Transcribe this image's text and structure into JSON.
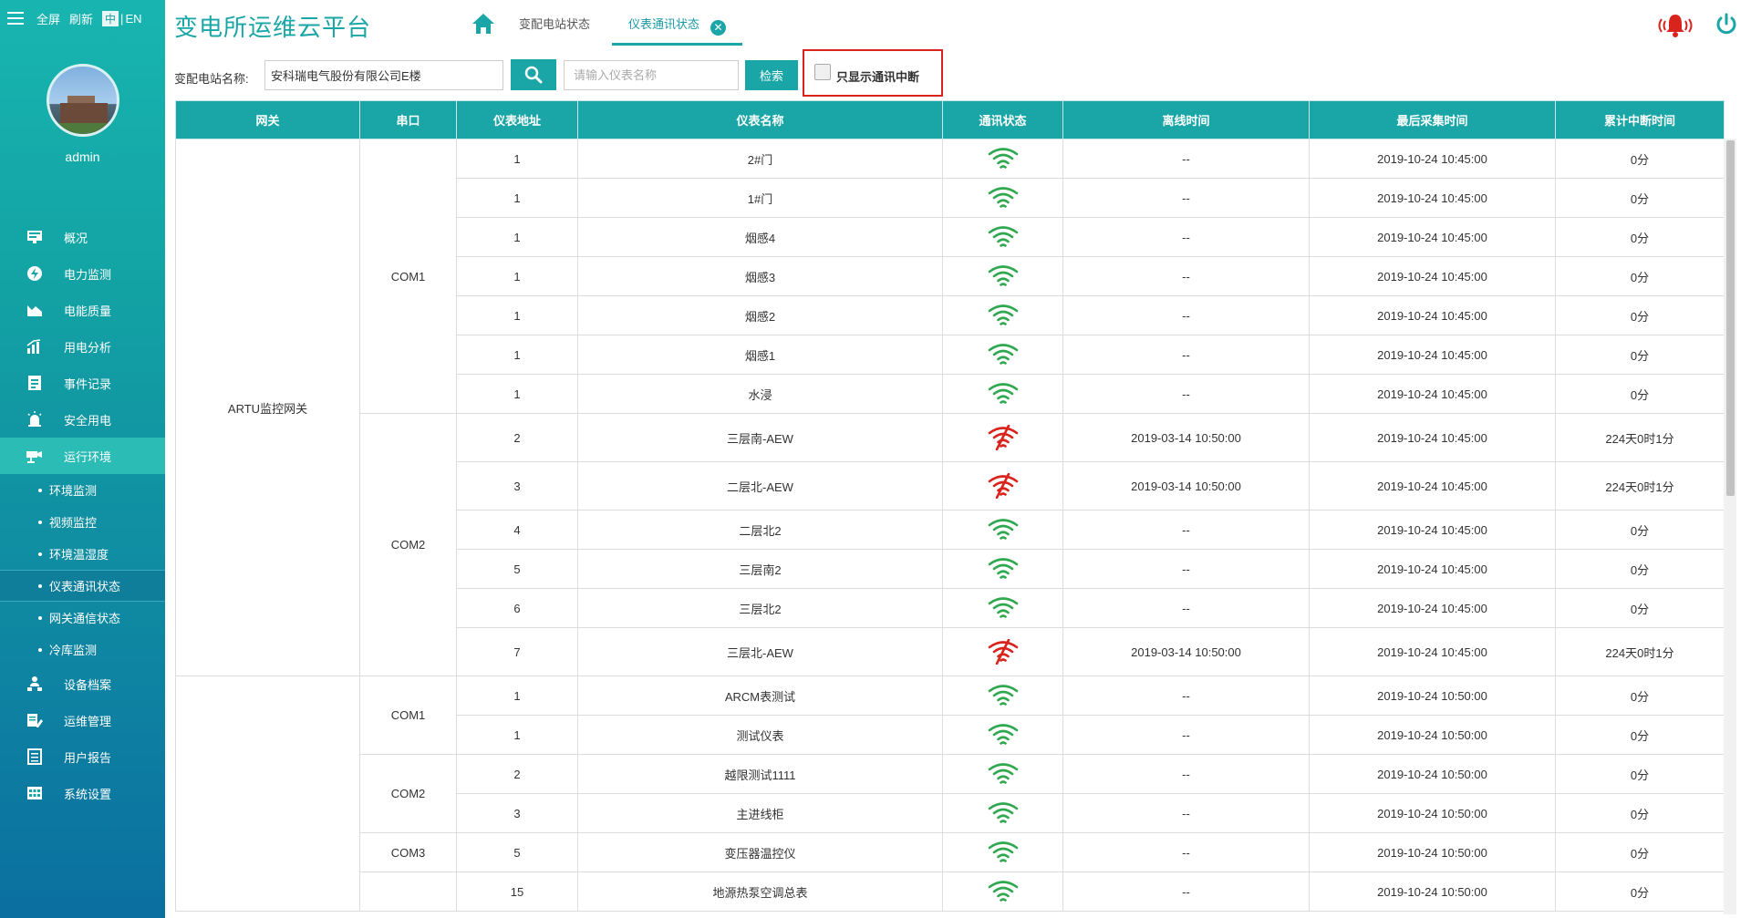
{
  "topbar": {
    "fullscreen": "全屏",
    "refresh": "刷新",
    "lang_zh": "中",
    "lang_sep": "|",
    "lang_en": "EN"
  },
  "user": {
    "name": "admin"
  },
  "nav": [
    {
      "label": "概况",
      "icon": "monitor-icon"
    },
    {
      "label": "电力监测",
      "icon": "power-monitor-icon"
    },
    {
      "label": "电能质量",
      "icon": "quality-chart-icon"
    },
    {
      "label": "用电分析",
      "icon": "bar-chart-icon"
    },
    {
      "label": "事件记录",
      "icon": "document-icon"
    },
    {
      "label": "安全用电",
      "icon": "alarm-light-icon"
    },
    {
      "label": "运行环境",
      "icon": "camera-icon",
      "active": true
    }
  ],
  "subnav": [
    {
      "label": "环境监测"
    },
    {
      "label": "视频监控"
    },
    {
      "label": "环境温湿度"
    },
    {
      "label": "仪表通讯状态",
      "active": true
    },
    {
      "label": "网关通信状态"
    },
    {
      "label": "冷库监测"
    }
  ],
  "nav_bottom": [
    {
      "label": "设备档案",
      "icon": "org-chart-icon"
    },
    {
      "label": "运维管理",
      "icon": "edit-doc-icon"
    },
    {
      "label": "用户报告",
      "icon": "report-icon"
    },
    {
      "label": "系统设置",
      "icon": "settings-grid-icon"
    }
  ],
  "header": {
    "title": "变电所运维云平台",
    "tabs": [
      "变配电站状态",
      "仪表通讯状态"
    ],
    "close_glyph": "✕"
  },
  "filter": {
    "station_label": "变配电站名称:",
    "station_value": "安科瑞电气股份有限公司E楼",
    "meter_placeholder": "请输入仪表名称",
    "query_label": "检索",
    "only_offline_label": "只显示通讯中断"
  },
  "table": {
    "columns": [
      "网关",
      "串口",
      "仪表地址",
      "仪表名称",
      "通讯状态",
      "离线时间",
      "最后采集时间",
      "累计中断时间"
    ],
    "groups": [
      {
        "gateway": "ARTU监控网关",
        "ports": [
          {
            "port": "COM1",
            "rows": [
              {
                "addr": "1",
                "name": "2#门",
                "ok": true,
                "offline": "--",
                "last": "2019-10-24 10:45:00",
                "total": "0分"
              },
              {
                "addr": "1",
                "name": "1#门",
                "ok": true,
                "offline": "--",
                "last": "2019-10-24 10:45:00",
                "total": "0分"
              },
              {
                "addr": "1",
                "name": "烟感4",
                "ok": true,
                "offline": "--",
                "last": "2019-10-24 10:45:00",
                "total": "0分"
              },
              {
                "addr": "1",
                "name": "烟感3",
                "ok": true,
                "offline": "--",
                "last": "2019-10-24 10:45:00",
                "total": "0分"
              },
              {
                "addr": "1",
                "name": "烟感2",
                "ok": true,
                "offline": "--",
                "last": "2019-10-24 10:45:00",
                "total": "0分"
              },
              {
                "addr": "1",
                "name": "烟感1",
                "ok": true,
                "offline": "--",
                "last": "2019-10-24 10:45:00",
                "total": "0分"
              },
              {
                "addr": "1",
                "name": "水浸",
                "ok": true,
                "offline": "--",
                "last": "2019-10-24 10:45:00",
                "total": "0分"
              }
            ]
          },
          {
            "port": "COM2",
            "rows": [
              {
                "addr": "2",
                "name": "三层南-AEW",
                "ok": false,
                "offline": "2019-03-14 10:50:00",
                "last": "2019-10-24 10:45:00",
                "total": "224天0时1分"
              },
              {
                "addr": "3",
                "name": "二层北-AEW",
                "ok": false,
                "offline": "2019-03-14 10:50:00",
                "last": "2019-10-24 10:45:00",
                "total": "224天0时1分"
              },
              {
                "addr": "4",
                "name": "二层北2",
                "ok": true,
                "offline": "--",
                "last": "2019-10-24 10:45:00",
                "total": "0分"
              },
              {
                "addr": "5",
                "name": "三层南2",
                "ok": true,
                "offline": "--",
                "last": "2019-10-24 10:45:00",
                "total": "0分"
              },
              {
                "addr": "6",
                "name": "三层北2",
                "ok": true,
                "offline": "--",
                "last": "2019-10-24 10:45:00",
                "total": "0分"
              },
              {
                "addr": "7",
                "name": "三层北-AEW",
                "ok": false,
                "offline": "2019-03-14 10:50:00",
                "last": "2019-10-24 10:45:00",
                "total": "224天0时1分"
              }
            ]
          }
        ]
      },
      {
        "gateway": "",
        "ports": [
          {
            "port": "COM1",
            "rows": [
              {
                "addr": "1",
                "name": "ARCM表测试",
                "ok": true,
                "offline": "--",
                "last": "2019-10-24 10:50:00",
                "total": "0分"
              },
              {
                "addr": "1",
                "name": "测试仪表",
                "ok": true,
                "offline": "--",
                "last": "2019-10-24 10:50:00",
                "total": "0分"
              }
            ]
          },
          {
            "port": "COM2",
            "rows": [
              {
                "addr": "2",
                "name": "越限测试1111",
                "ok": true,
                "offline": "--",
                "last": "2019-10-24 10:50:00",
                "total": "0分"
              },
              {
                "addr": "3",
                "name": "主进线柜",
                "ok": true,
                "offline": "--",
                "last": "2019-10-24 10:50:00",
                "total": "0分"
              }
            ]
          },
          {
            "port": "COM3",
            "rows": [
              {
                "addr": "5",
                "name": "变压器温控仪",
                "ok": true,
                "offline": "--",
                "last": "2019-10-24 10:50:00",
                "total": "0分"
              }
            ]
          },
          {
            "port": "",
            "rows": [
              {
                "addr": "15",
                "name": "地源热泵空调总表",
                "ok": true,
                "offline": "--",
                "last": "2019-10-24 10:50:00",
                "total": "0分"
              }
            ]
          }
        ]
      }
    ]
  },
  "colors": {
    "accent": "#1aa6a6",
    "signal_ok": "#2fa84f",
    "signal_bad": "#d9231d",
    "highlight_border": "#d9231d"
  }
}
